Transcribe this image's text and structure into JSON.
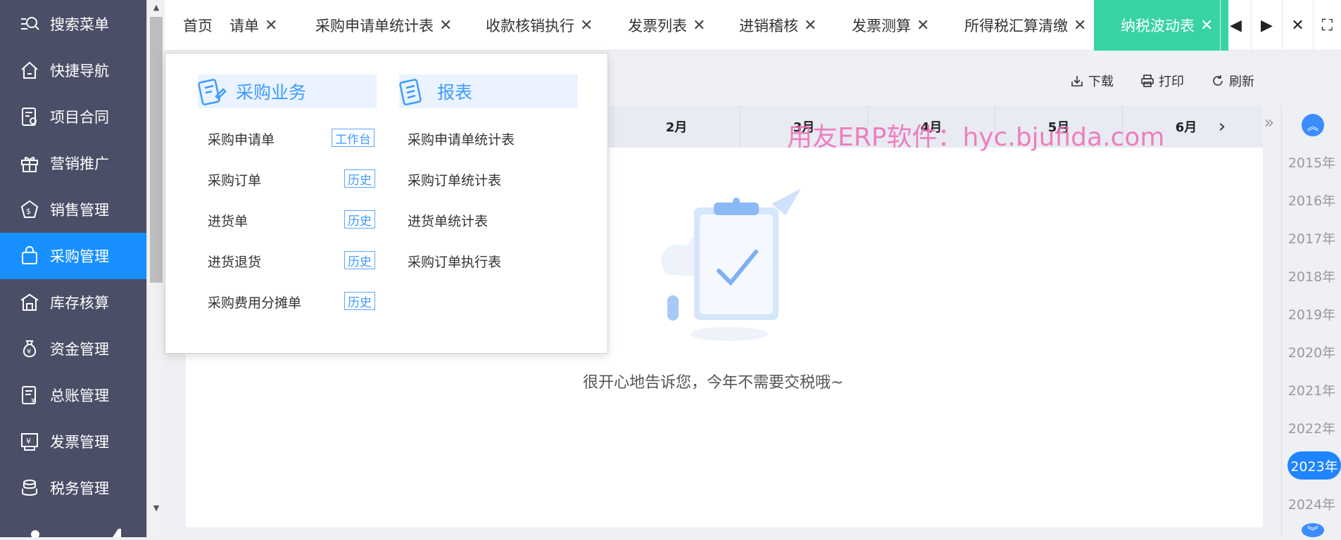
{
  "sidebar": {
    "items": [
      {
        "label": "搜索菜单",
        "icon": "search-menu-icon"
      },
      {
        "label": "快捷导航",
        "icon": "home-icon"
      },
      {
        "label": "项目合同",
        "icon": "contract-icon"
      },
      {
        "label": "营销推广",
        "icon": "gift-icon"
      },
      {
        "label": "销售管理",
        "icon": "sales-icon"
      },
      {
        "label": "采购管理",
        "icon": "shopping-bag-icon",
        "active": true
      },
      {
        "label": "库存核算",
        "icon": "warehouse-icon"
      },
      {
        "label": "资金管理",
        "icon": "money-bag-icon"
      },
      {
        "label": "总账管理",
        "icon": "ledger-icon"
      },
      {
        "label": "发票管理",
        "icon": "invoice-icon"
      },
      {
        "label": "税务管理",
        "icon": "tax-icon"
      }
    ]
  },
  "tabs": [
    {
      "label": "首页",
      "closable": false
    },
    {
      "label": "请单",
      "closable": true
    },
    {
      "label": "采购申请单统计表",
      "closable": true
    },
    {
      "label": "收款核销执行",
      "closable": true
    },
    {
      "label": "发票列表",
      "closable": true
    },
    {
      "label": "进销稽核",
      "closable": true
    },
    {
      "label": "发票测算",
      "closable": true
    },
    {
      "label": "所得税汇算清缴",
      "closable": true
    },
    {
      "label": "纳税波动表",
      "closable": true,
      "active": true
    }
  ],
  "tab_controls": {
    "prev": "◀",
    "next": "▶",
    "close": "✕",
    "fullscreen": "⛶"
  },
  "toolbar": {
    "download": "下载",
    "print": "打印",
    "refresh": "刷新"
  },
  "months": [
    "2月",
    "3月",
    "4月",
    "5月",
    "6月"
  ],
  "month_next": "›",
  "watermark": "用友ERP软件：hyc.bjufida.com",
  "empty_message": "很开心地告诉您，今年不需要交税哦~",
  "years": [
    "2015年",
    "2016年",
    "2017年",
    "2018年",
    "2019年",
    "2020年",
    "2021年",
    "2022年",
    "2023年",
    "2024年"
  ],
  "active_year": "2023年",
  "dropdown": {
    "group1": {
      "title": "采购业务",
      "items": [
        {
          "label": "采购申请单",
          "badge": "工作台"
        },
        {
          "label": "采购订单",
          "badge": "历史"
        },
        {
          "label": "进货单",
          "badge": "历史"
        },
        {
          "label": "进货退货",
          "badge": "历史"
        },
        {
          "label": "采购费用分摊单",
          "badge": "历史"
        }
      ]
    },
    "group2": {
      "title": "报表",
      "items": [
        {
          "label": "采购申请单统计表"
        },
        {
          "label": "采购订单统计表"
        },
        {
          "label": "进货单统计表"
        },
        {
          "label": "采购订单执行表"
        }
      ]
    }
  },
  "colors": {
    "sidebar_bg": "#4a4e67",
    "active_blue": "#1890ff",
    "active_tab": "#37d3a3",
    "accent": "#3f9bff"
  }
}
